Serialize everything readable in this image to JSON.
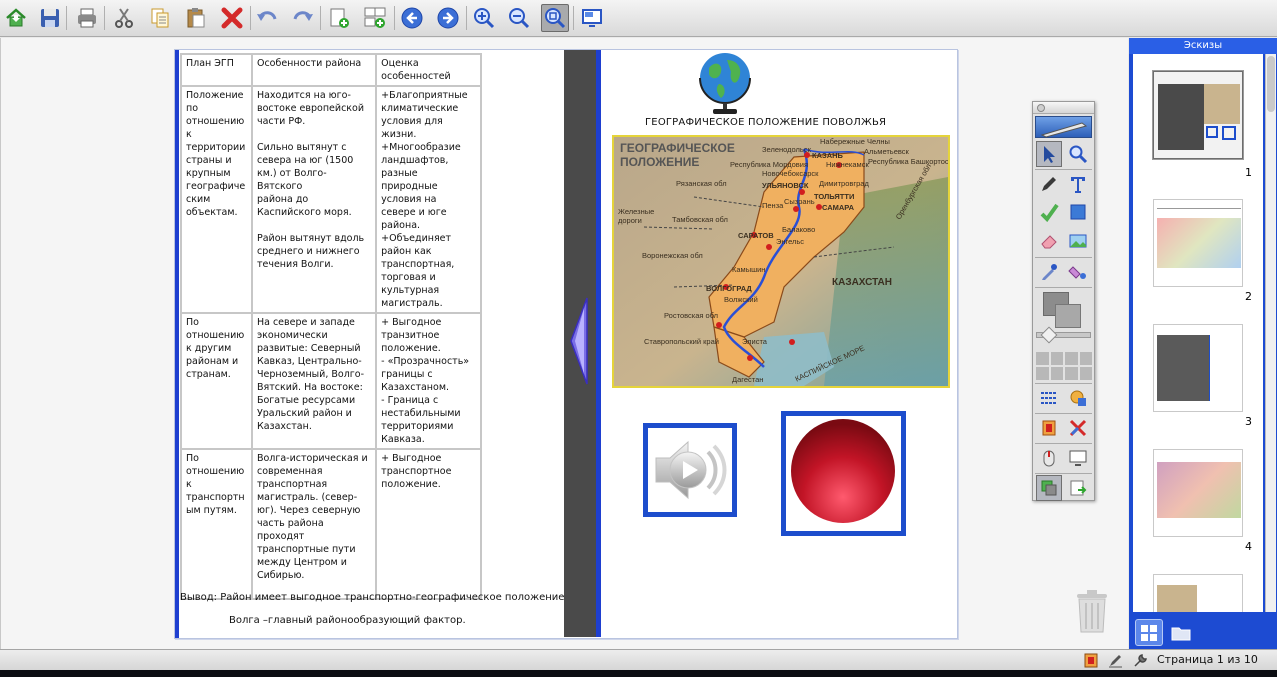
{
  "toolbar": {
    "buttons": [
      "home-icon",
      "save-icon",
      "print-icon",
      "cut-icon",
      "copy-icon",
      "paste-icon",
      "delete-icon",
      "undo-icon",
      "redo-icon",
      "new-page-icon",
      "duplicate-page-icon",
      "back-icon",
      "forward-icon",
      "zoom-in-icon",
      "zoom-out-icon",
      "fit-page-icon",
      "screen-icon"
    ]
  },
  "table": {
    "headers": [
      "План ЭГП",
      "Особенности района",
      "Оценка особенностей"
    ],
    "rows": [
      {
        "plan": "Положение\nпо\nотношению\nк\nтерритории\nстраны и\nкрупным\nгеографиче\nским\nобъектам.",
        "features": "Находится на юго-\nвостоке европейской\nчасти РФ.\n\nСильно вытянут с\nсевера на юг (1500\nкм.) от Волго-Вятского\nрайона до\nКаспийского моря.\n\nРайон вытянут вдоль\nсреднего и нижнего\nтечения Волги.",
        "rating": "+Благоприятные\nклиматические\nусловия для\nжизни.\n+Многообразие\nландшафтов,\nразные\nприродные\nусловия на\nсевере и юге\nрайона.\n+Объединяет\nрайон как\nтранспортная,\nторговая и\nкультурная\nмагистраль."
      },
      {
        "plan": "По\nотношению\nк другим\nрайонам и\nстранам.",
        "features": "На севере и западе\nэкономически\nразвитые: Северный\nКавказ, Центрально-\nЧерноземный, Волго-\nВятский. На востоке:\nБогатые ресурсами\nУральский район и\nКазахстан.",
        "rating": "+ Выгодное\nтранзитное\nположение.\n- «Прозрачность»\nграницы с\nКазахстаном.\n- Граница с\nнестабильными\nтерриториями\nКавказа."
      },
      {
        "plan": "По\nотношению\nк\nтранспортн\nым путям.",
        "features": "Волга-историческая и\nсовременная\nтранспортная\nмагистраль. (север-\nюг). Через северную\nчасть района\nпроходят\nтранспортные пути\nмежду Центром и\nСибирью.",
        "rating": "+ Выгодное\nтранспортное\nположение."
      }
    ]
  },
  "conclusion_line1": "Вывод:  Район имеет выгодное транспортно-географическое    положение.",
  "conclusion_line2": "Волга –главный районообразующий фактор.",
  "slide_title": "ГЕОГРАФИЧЕСКОЕ ПОЛОЖЕНИЕ ПОВОЛЖЬЯ",
  "map": {
    "heading": "ГЕОГРАФИЧЕСКОЕ\nПОЛОЖЕНИЕ",
    "legend": "Железные\nдороги",
    "labels": [
      "Зеленодольск",
      "Набережные Челны",
      "КАЗАНЬ",
      "Нижнекамск",
      "Альметьевск",
      "Республика Мордовия",
      "Новочебоксарск",
      "Республика Башкортостан",
      "Рязанская обл",
      "УЛЬЯНОВСК",
      "Димитровград",
      "Пенза",
      "ТОЛЬЯТТИ",
      "Сызрань",
      "САМАРА",
      "Оренбургская обл",
      "Тамбовская обл",
      "Балаково",
      "САРАТОВ",
      "Энгельс",
      "Воронежская обл",
      "Камышин",
      "КАЗАХСТАН",
      "ВОЛГОГРАД",
      "Волжский",
      "Ростовская обл",
      "Элиста",
      "Ставропольский край",
      "Дагестан",
      "КАСПИЙСКОЕ МОРЕ"
    ]
  },
  "tools_panel": {
    "tools": [
      "select-icon",
      "zoom-tool-icon",
      "pen-icon",
      "text-tool-icon",
      "highlighter-icon",
      "shape-icon",
      "eraser-icon",
      "image-icon",
      "eyedropper-icon",
      "fill-icon",
      "color-swatch",
      "line-style-icon",
      "shadow-icon",
      "record-tool-icon",
      "clear-icon",
      "mouse-icon",
      "screen-capture-icon",
      "layers-icon",
      "export-icon"
    ]
  },
  "thumbnails": {
    "header": "Эскизы",
    "pages": [
      "1",
      "2",
      "3",
      "4"
    ]
  },
  "status": {
    "page_text": "Страница 1 из 10"
  },
  "colors": {
    "accent_blue": "#1d4dcc",
    "thumbs_blue": "#1d4bd2",
    "record_red": "#b1121f"
  }
}
